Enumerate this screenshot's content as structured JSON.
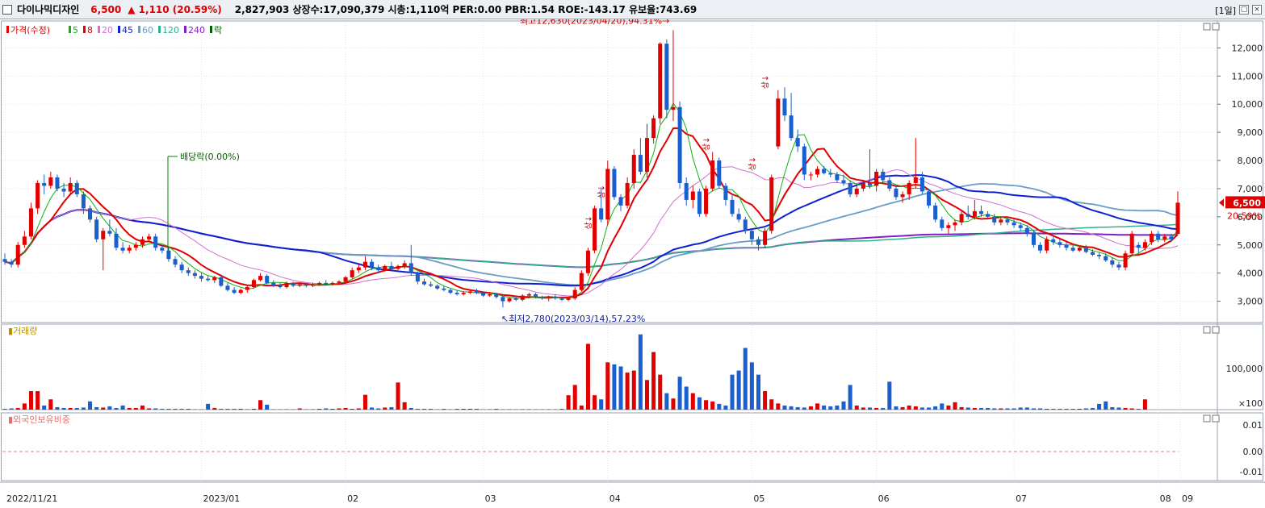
{
  "header": {
    "name": "다이나믹디자인",
    "price": "6,500",
    "change": "▲ 1,110 (20.59%)",
    "stats": "2,827,903  상장수:17,090,379  시총:1,110억  PER:0.00  PBR:1.54  ROE:-143.17  유보율:743.69",
    "period": "[1일]"
  },
  "legend": {
    "items": [
      {
        "label": "가격(수정)",
        "color": "#e00000"
      },
      {
        "label": "5",
        "color": "#10b010"
      },
      {
        "label": "8",
        "color": "#e00000"
      },
      {
        "label": "20",
        "color": "#d070d0"
      },
      {
        "label": "45",
        "color": "#1020d0"
      },
      {
        "label": "60",
        "color": "#6a9cc8"
      },
      {
        "label": "120",
        "color": "#30b090"
      },
      {
        "label": "240",
        "color": "#8020c0"
      },
      {
        "label": "락",
        "color": "#006000"
      }
    ]
  },
  "annotations": {
    "high": "최고12,630(2023/04/20),94.31%",
    "low": "최저2,780(2023/03/14),57.23%",
    "dividend": "배당락(0.00%)",
    "sang": "상"
  },
  "price_badge": {
    "value": "6,500",
    "pct": "20.59%"
  },
  "volume_panel": {
    "title": "거래량",
    "scale": "×100",
    "tick": "100,000"
  },
  "foreign_panel": {
    "title": "외국인보유비중",
    "ticks": [
      "0.01",
      "0.00",
      "-0.01"
    ]
  },
  "colors": {
    "up": "#e00000",
    "down": "#1a5fd0",
    "grid": "#dfe3ea"
  },
  "chart_data": {
    "type": "candlestick",
    "x_labels": [
      "2022/11/21",
      "2023/01",
      "02",
      "03",
      "04",
      "05",
      "06",
      "07",
      "08",
      "09"
    ],
    "y_ticks": [
      "12,000",
      "11,000",
      "10,000",
      "9,000",
      "8,000",
      "7,000",
      "6,000",
      "5,000",
      "4,000",
      "3,000"
    ],
    "ylim": [
      2300,
      12900
    ],
    "candles": [
      [
        4500,
        4700,
        4300,
        4400
      ],
      [
        4400,
        4500,
        4200,
        4300
      ],
      [
        4300,
        5100,
        4200,
        5000
      ],
      [
        5000,
        5500,
        4900,
        5300
      ],
      [
        5300,
        6500,
        5200,
        6300
      ],
      [
        6300,
        7300,
        6100,
        7200
      ],
      [
        7200,
        7500,
        6800,
        7100
      ],
      [
        7100,
        7600,
        7000,
        7400
      ],
      [
        7400,
        7500,
        6900,
        7000
      ],
      [
        7000,
        7200,
        6700,
        6900
      ],
      [
        6900,
        7400,
        6800,
        7200
      ],
      [
        7200,
        7300,
        6700,
        6800
      ],
      [
        6800,
        6900,
        6100,
        6300
      ],
      [
        6300,
        6400,
        5800,
        5900
      ],
      [
        5900,
        6000,
        5100,
        5200
      ],
      [
        5200,
        5600,
        4100,
        5500
      ],
      [
        5500,
        5900,
        5300,
        5400
      ],
      [
        5400,
        5600,
        4800,
        4900
      ],
      [
        4900,
        5100,
        4700,
        4800
      ],
      [
        4800,
        5000,
        4700,
        4900
      ],
      [
        4900,
        5100,
        4800,
        5000
      ],
      [
        5000,
        5300,
        4900,
        5200
      ],
      [
        5200,
        5400,
        5100,
        5300
      ],
      [
        5300,
        5400,
        4800,
        4900
      ],
      [
        4900,
        5000,
        4700,
        4800
      ],
      [
        4800,
        4900,
        4400,
        4500
      ],
      [
        4500,
        4600,
        4200,
        4300
      ],
      [
        4300,
        4400,
        4000,
        4100
      ],
      [
        4100,
        4200,
        3900,
        4000
      ],
      [
        4000,
        4100,
        3800,
        3900
      ],
      [
        3900,
        4000,
        3700,
        3800
      ],
      [
        3800,
        3900,
        3700,
        3750
      ],
      [
        3750,
        3900,
        3650,
        3850
      ],
      [
        3850,
        3950,
        3500,
        3550
      ],
      [
        3550,
        3650,
        3350,
        3400
      ],
      [
        3400,
        3500,
        3250,
        3300
      ],
      [
        3300,
        3450,
        3250,
        3400
      ],
      [
        3400,
        3550,
        3300,
        3500
      ],
      [
        3500,
        3800,
        3450,
        3750
      ],
      [
        3750,
        4000,
        3700,
        3900
      ],
      [
        3900,
        3950,
        3600,
        3650
      ],
      [
        3650,
        3750,
        3500,
        3550
      ],
      [
        3550,
        3650,
        3450,
        3500
      ],
      [
        3500,
        3700,
        3450,
        3650
      ],
      [
        3650,
        3700,
        3500,
        3550
      ],
      [
        3550,
        3650,
        3500,
        3600
      ],
      [
        3600,
        3650,
        3500,
        3550
      ],
      [
        3550,
        3650,
        3500,
        3600
      ],
      [
        3600,
        3700,
        3550,
        3650
      ],
      [
        3650,
        3750,
        3550,
        3600
      ],
      [
        3600,
        3700,
        3550,
        3650
      ],
      [
        3650,
        3750,
        3600,
        3700
      ],
      [
        3700,
        3900,
        3650,
        3850
      ],
      [
        3850,
        4200,
        3800,
        4100
      ],
      [
        4100,
        4300,
        4000,
        4200
      ],
      [
        4200,
        4600,
        4100,
        4400
      ],
      [
        4400,
        4500,
        4100,
        4200
      ],
      [
        4200,
        4300,
        4000,
        4100
      ],
      [
        4100,
        4300,
        4050,
        4250
      ],
      [
        4250,
        4400,
        4100,
        4150
      ],
      [
        4150,
        4300,
        4100,
        4250
      ],
      [
        4250,
        4450,
        4150,
        4350
      ],
      [
        4350,
        5000,
        3900,
        4000
      ],
      [
        4000,
        4050,
        3600,
        3700
      ],
      [
        3700,
        3800,
        3550,
        3600
      ],
      [
        3600,
        3700,
        3500,
        3550
      ],
      [
        3550,
        3600,
        3400,
        3450
      ],
      [
        3450,
        3550,
        3350,
        3400
      ],
      [
        3400,
        3450,
        3250,
        3300
      ],
      [
        3300,
        3400,
        3200,
        3250
      ],
      [
        3250,
        3350,
        3200,
        3300
      ],
      [
        3300,
        3400,
        3250,
        3350
      ],
      [
        3350,
        3450,
        3250,
        3300
      ],
      [
        3300,
        3350,
        3150,
        3200
      ],
      [
        3200,
        3300,
        3150,
        3250
      ],
      [
        3250,
        3300,
        3100,
        3150
      ],
      [
        3150,
        3200,
        2780,
        3000
      ],
      [
        3000,
        3150,
        2950,
        3100
      ],
      [
        3100,
        3200,
        3000,
        3050
      ],
      [
        3050,
        3250,
        3000,
        3200
      ],
      [
        3200,
        3300,
        3100,
        3250
      ],
      [
        3250,
        3300,
        3100,
        3150
      ],
      [
        3150,
        3200,
        3050,
        3100
      ],
      [
        3100,
        3200,
        3000,
        3150
      ],
      [
        3150,
        3250,
        3050,
        3100
      ],
      [
        3100,
        3150,
        3000,
        3050
      ],
      [
        3050,
        3150,
        3000,
        3100
      ],
      [
        3100,
        3500,
        3050,
        3400
      ],
      [
        3400,
        4100,
        3350,
        4000
      ],
      [
        4000,
        4900,
        3900,
        4800
      ],
      [
        4800,
        6400,
        4700,
        6300
      ],
      [
        6300,
        7000,
        5800,
        5900
      ],
      [
        5900,
        8000,
        5700,
        7700
      ],
      [
        7700,
        7800,
        6600,
        6700
      ],
      [
        6700,
        6800,
        6200,
        6400
      ],
      [
        6400,
        7400,
        6300,
        7200
      ],
      [
        7200,
        8400,
        7000,
        8200
      ],
      [
        8200,
        8800,
        7500,
        7600
      ],
      [
        7600,
        9300,
        7400,
        8800
      ],
      [
        8800,
        9600,
        8600,
        9500
      ],
      [
        9500,
        12200,
        9300,
        12150
      ],
      [
        12150,
        12300,
        9500,
        9800
      ],
      [
        9800,
        12630,
        9400,
        9900
      ],
      [
        9900,
        10100,
        7000,
        7200
      ],
      [
        7200,
        7400,
        6400,
        6600
      ],
      [
        6600,
        7100,
        6300,
        6900
      ],
      [
        6900,
        7000,
        6000,
        6100
      ],
      [
        6100,
        7100,
        6000,
        7000
      ],
      [
        7000,
        8300,
        6900,
        8000
      ],
      [
        8000,
        8100,
        7000,
        7100
      ],
      [
        7100,
        7200,
        6400,
        6600
      ],
      [
        6600,
        6800,
        6000,
        6100
      ],
      [
        6100,
        6300,
        5800,
        5900
      ],
      [
        5900,
        6000,
        5400,
        5500
      ],
      [
        5500,
        5600,
        5000,
        5200
      ],
      [
        5200,
        5300,
        4800,
        5000
      ],
      [
        5000,
        5600,
        4900,
        5500
      ],
      [
        5500,
        7500,
        5400,
        7400
      ],
      [
        8500,
        10500,
        8400,
        10200
      ],
      [
        10200,
        10600,
        9400,
        9600
      ],
      [
        9600,
        10400,
        8700,
        8800
      ],
      [
        8800,
        9100,
        8300,
        8500
      ],
      [
        8500,
        8600,
        7300,
        7500
      ],
      [
        7500,
        7600,
        7300,
        7500
      ],
      [
        7500,
        7800,
        7400,
        7700
      ],
      [
        7700,
        7800,
        7500,
        7550
      ],
      [
        7550,
        7700,
        7400,
        7500
      ],
      [
        7500,
        7600,
        7200,
        7300
      ],
      [
        7300,
        7500,
        7100,
        7200
      ],
      [
        7200,
        7300,
        6700,
        6800
      ],
      [
        6800,
        7100,
        6700,
        7000
      ],
      [
        7000,
        7300,
        6900,
        7200
      ],
      [
        7200,
        8400,
        7000,
        7100
      ],
      [
        7100,
        7700,
        6900,
        7600
      ],
      [
        7600,
        7700,
        7200,
        7300
      ],
      [
        7300,
        7400,
        6900,
        7000
      ],
      [
        7000,
        7100,
        6600,
        6700
      ],
      [
        6700,
        6900,
        6500,
        6800
      ],
      [
        6800,
        7300,
        6600,
        7200
      ],
      [
        7200,
        8800,
        7000,
        7400
      ],
      [
        7400,
        7600,
        6800,
        6900
      ],
      [
        6900,
        7000,
        6300,
        6400
      ],
      [
        6400,
        6500,
        5800,
        5900
      ],
      [
        5900,
        6000,
        5500,
        5600
      ],
      [
        5600,
        5800,
        5400,
        5700
      ],
      [
        5700,
        5900,
        5500,
        5800
      ],
      [
        5800,
        6200,
        5700,
        6100
      ],
      [
        6100,
        6400,
        5900,
        6000
      ],
      [
        6000,
        6600,
        5900,
        6200
      ],
      [
        6200,
        6400,
        6000,
        6100
      ],
      [
        6100,
        6200,
        5900,
        6000
      ],
      [
        6000,
        6100,
        5700,
        5800
      ],
      [
        5800,
        6000,
        5700,
        5900
      ],
      [
        5900,
        6000,
        5700,
        5800
      ],
      [
        5800,
        5900,
        5600,
        5700
      ],
      [
        5700,
        5800,
        5500,
        5600
      ],
      [
        5600,
        5700,
        5300,
        5400
      ],
      [
        5400,
        5500,
        4900,
        5000
      ],
      [
        5000,
        5100,
        4700,
        4800
      ],
      [
        4800,
        5300,
        4700,
        5200
      ],
      [
        5200,
        5300,
        5000,
        5100
      ],
      [
        5100,
        5200,
        4900,
        5000
      ],
      [
        5000,
        5100,
        4800,
        4900
      ],
      [
        4900,
        5000,
        4750,
        4800
      ],
      [
        4800,
        4950,
        4750,
        4900
      ],
      [
        4900,
        5000,
        4700,
        4750
      ],
      [
        4750,
        4850,
        4600,
        4650
      ],
      [
        4650,
        4750,
        4500,
        4600
      ],
      [
        4600,
        4700,
        4400,
        4450
      ],
      [
        4450,
        4550,
        4200,
        4300
      ],
      [
        4300,
        4400,
        4100,
        4200
      ],
      [
        4200,
        4800,
        4100,
        4700
      ],
      [
        4700,
        5500,
        4600,
        5400
      ],
      [
        5000,
        5100,
        4700,
        4900
      ],
      [
        4900,
        5200,
        4800,
        5100
      ],
      [
        5100,
        5500,
        5000,
        5400
      ],
      [
        5400,
        5500,
        5100,
        5200
      ],
      [
        5200,
        5400,
        5100,
        5300
      ],
      [
        5300,
        5400,
        5100,
        5200
      ],
      [
        5390,
        6900,
        5390,
        6500
      ]
    ],
    "volume_ylim": [
      0,
      200000
    ],
    "volume": [
      2000,
      3000,
      4000,
      15000,
      45000,
      45000,
      10000,
      25000,
      6000,
      4000,
      4000,
      4000,
      5000,
      20000,
      6000,
      5000,
      8000,
      4000,
      10000,
      4000,
      4000,
      10000,
      3000,
      3000,
      2000,
      2000,
      2000,
      2000,
      2000,
      1000,
      1000,
      14000,
      4000,
      2000,
      2000,
      2000,
      2000,
      1000,
      2000,
      23000,
      12000,
      1000,
      1000,
      1000,
      1000,
      3000,
      1000,
      1000,
      2000,
      3000,
      2000,
      3000,
      4000,
      2000,
      3000,
      36000,
      5000,
      3000,
      5000,
      6000,
      66000,
      18000,
      4000,
      2000,
      2000,
      2000,
      1000,
      2000,
      1000,
      2000,
      2000,
      2000,
      2000,
      1000,
      1000,
      2000,
      1000,
      1000,
      1000,
      1000,
      1000,
      1000,
      1000,
      1000,
      1000,
      2000,
      35000,
      60000,
      10000,
      160000,
      35000,
      25000,
      115000,
      110000,
      105000,
      90000,
      95000,
      183000,
      72000,
      140000,
      85000,
      40000,
      27000,
      80000,
      56000,
      40000,
      30000,
      23000,
      20000,
      14000,
      10000,
      85000,
      95000,
      150000,
      115000,
      85000,
      45000,
      25000,
      15000,
      10000,
      8000,
      6000,
      5000,
      8000,
      15000,
      10000,
      8000,
      10000,
      20000,
      60000,
      10000,
      5000,
      5000,
      4000,
      4000,
      68000,
      8000,
      6000,
      10000,
      8000,
      5000,
      5000,
      8000,
      15000,
      10000,
      18000,
      6000,
      5000,
      4000,
      4000,
      4000,
      3000,
      3000,
      3000,
      3000,
      5000,
      5000,
      3000,
      3000,
      2000,
      2000,
      2000,
      2000,
      2000,
      2000,
      3000,
      4000,
      14000,
      20000,
      6000,
      5000,
      4000,
      3000,
      2000,
      25000
    ]
  }
}
